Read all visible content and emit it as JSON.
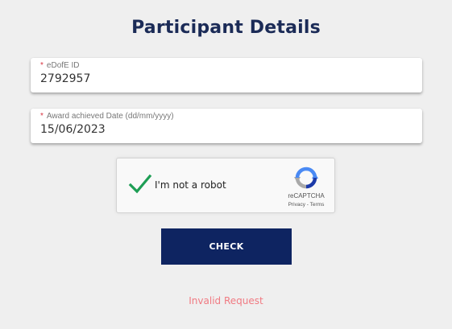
{
  "page": {
    "title": "Participant Details"
  },
  "fields": {
    "edofe_id": {
      "required_mark": "*",
      "label": "eDofE ID",
      "value": "2792957"
    },
    "award_date": {
      "required_mark": "*",
      "label": "Award achieved Date (dd/mm/yyyy)",
      "value": "15/06/2023"
    }
  },
  "captcha": {
    "label": "I'm not a robot",
    "checked": true,
    "brand": "reCAPTCHA",
    "links": "Privacy - Terms",
    "check_color": "#1e9e55",
    "icon": "recaptcha-logo-icon"
  },
  "actions": {
    "check_label": "CHECK",
    "button_color": "#0e2461"
  },
  "status": {
    "message": "Invalid Request",
    "message_color": "#f07a82"
  },
  "colors": {
    "background": "#efefef",
    "title": "#1b2b57",
    "required": "#d9333f"
  }
}
